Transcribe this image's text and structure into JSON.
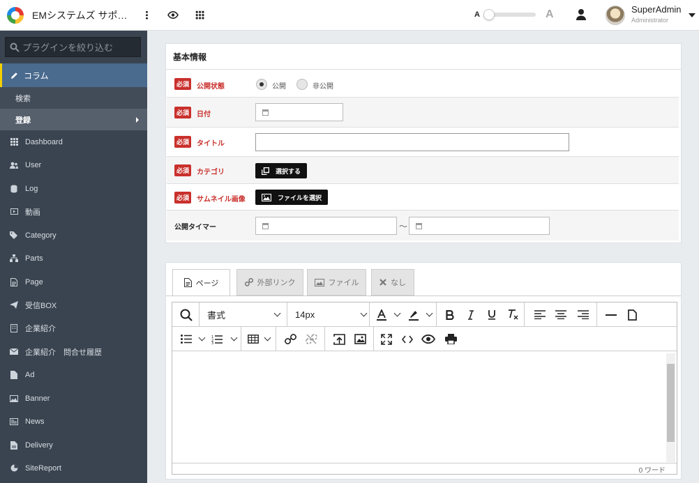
{
  "header": {
    "app_title": "EMシステムズ サポ…",
    "font_small": "A",
    "font_large": "A",
    "font_level": 0.0,
    "user_name": "SuperAdmin",
    "user_role": "Administrator"
  },
  "sidebar": {
    "search_placeholder": "プラグインを絞り込む",
    "active_item": "コラム",
    "sub_items": [
      "検索",
      "登録"
    ],
    "items": [
      "Dashboard",
      "User",
      "Log",
      "動画",
      "Category",
      "Parts",
      "Page",
      "受信BOX",
      "企業紹介",
      "企業紹介　問合せ履歴",
      "Ad",
      "Banner",
      "News",
      "Delivery",
      "SiteReport"
    ]
  },
  "form": {
    "panel_title": "基本情報",
    "required_badge": "必須",
    "status_label": "公開状態",
    "status_options": [
      "公開",
      "非公開"
    ],
    "status_selected": "公開",
    "date_label": "日付",
    "date_value": "",
    "title_label": "タイトル",
    "title_value": "",
    "category_label": "カテゴリ",
    "category_button": "選択する",
    "thumbnail_label": "サムネイル画像",
    "thumbnail_button": "ファイルを選択",
    "timer_label": "公開タイマー",
    "timer_separator": "〜"
  },
  "editor_panel": {
    "tabs": [
      "ページ",
      "外部リンク",
      "ファイル",
      "なし"
    ],
    "active_tab": "ページ",
    "format_label": "書式",
    "font_size": "14px",
    "word_count": "0 ワード"
  },
  "colors": {
    "sidebar_bg": "#3a4450",
    "active_nav": "#4a6a8e",
    "accent_bar": "#f5d000",
    "required_red": "#c9302c"
  }
}
